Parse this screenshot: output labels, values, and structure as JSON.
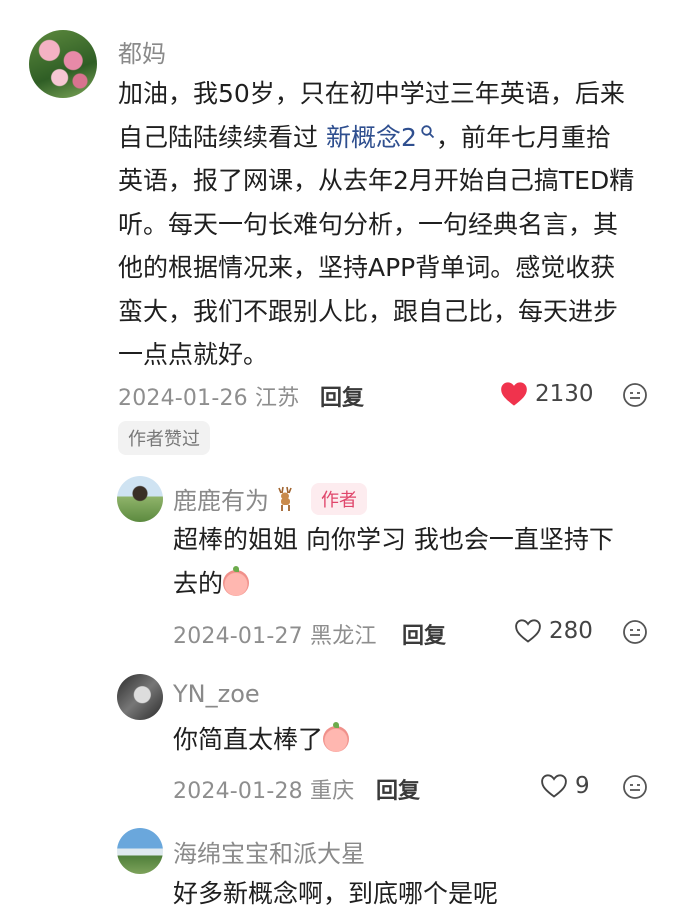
{
  "comment_main": {
    "username": "都妈",
    "text_part1": "加油，我50岁，只在初中学过三年英语，后来",
    "text_part2_before_link": "自己陆陆续续看过 ",
    "link_text": "新概念2",
    "text_part2_after_link": "，前年七月重拾",
    "text_lines": [
      "英语，报了网课，从去年2月开始自己搞TED精",
      "听。每天一句长难句分析，一句经典名言，其",
      "他的根据情况来，坚持APP背单词。感觉收获",
      "蛮大，我们不跟别人比，跟自己比，每天进步",
      "一点点就好。"
    ],
    "meta": "2024-01-26 江苏",
    "reply_label": "回复",
    "like_count": "2130",
    "badge": "作者赞过"
  },
  "reply1": {
    "username": "鹿鹿有为",
    "author_tag": "作者",
    "text_line1": "超棒的姐姐 向你学习 我也会一直坚持下",
    "text_line2": "去的",
    "meta": "2024-01-27 黑龙江",
    "reply_label": "回复",
    "like_count": "280"
  },
  "reply2": {
    "username": "YN_zoe",
    "text": "你简直太棒了",
    "meta": "2024-01-28 重庆",
    "reply_label": "回复",
    "like_count": "9"
  },
  "reply3": {
    "username": "海绵宝宝和派大星",
    "text": "好多新概念啊，到底哪个是呢"
  },
  "colors": {
    "like_red": "#f0334d",
    "link_blue": "#2f4f8f",
    "author_pink": "#e0466b"
  }
}
